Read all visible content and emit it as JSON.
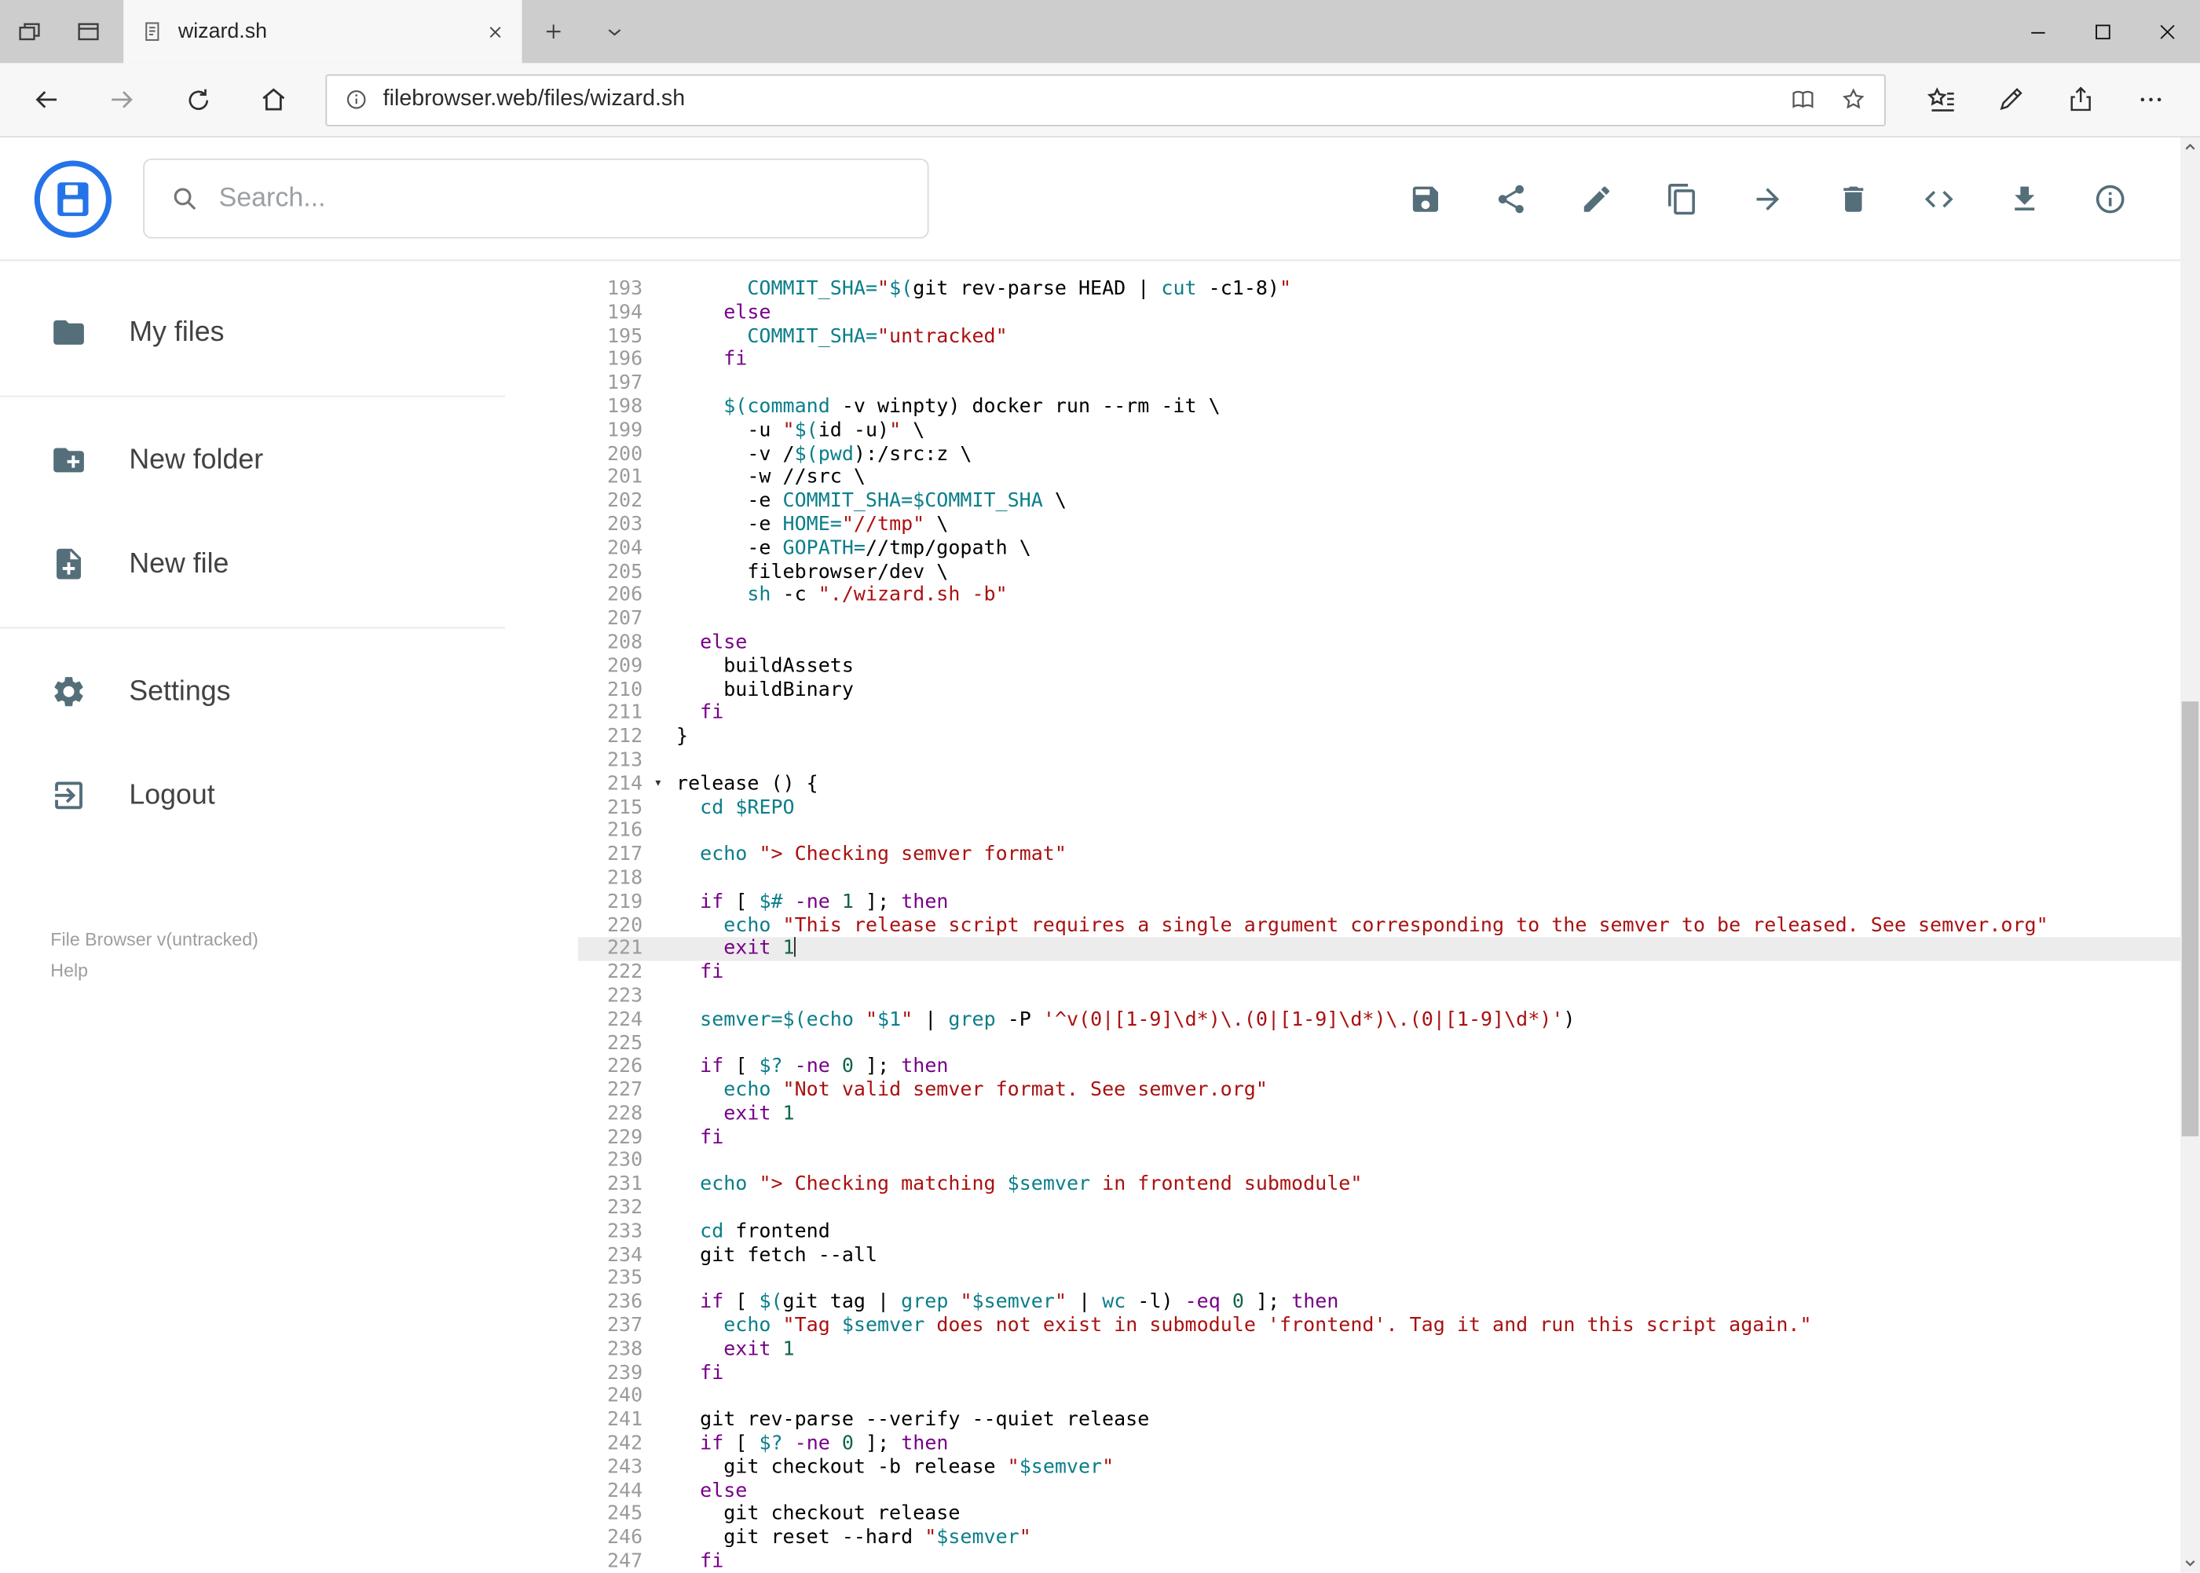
{
  "browser": {
    "tab": {
      "title": "wizard.sh"
    },
    "address": {
      "url": "filebrowser.web/files/wizard.sh"
    }
  },
  "app": {
    "search": {
      "placeholder": "Search..."
    },
    "toolbar_icons": [
      "save",
      "share",
      "edit",
      "copy",
      "move",
      "delete",
      "code",
      "download",
      "info"
    ],
    "sidebar": {
      "items": [
        {
          "label": "My files",
          "icon": "folder"
        },
        {
          "label": "New folder",
          "icon": "folder-plus"
        },
        {
          "label": "New file",
          "icon": "file-plus"
        },
        {
          "label": "Settings",
          "icon": "gear"
        },
        {
          "label": "Logout",
          "icon": "logout"
        }
      ],
      "footer": {
        "version": "File Browser v(untracked)",
        "help": "Help"
      }
    }
  },
  "colors": {
    "accent_blue": "#2573e8",
    "icon_gray": "#546e7a",
    "keyword": "#770088",
    "string": "#aa1111",
    "variable": "#0b7e8a",
    "number": "#116644",
    "line_number": "#9b9b9b",
    "active_line_bg": "#ececec"
  },
  "editor": {
    "active_line": 221,
    "fold_line": 214,
    "lines": [
      {
        "n": 193,
        "t": [
          [
            "p",
            "      "
          ],
          [
            "v",
            "COMMIT_SHA="
          ],
          [
            "s",
            "\""
          ],
          [
            "v",
            "$("
          ],
          [
            "p",
            "git rev-parse HEAD | "
          ],
          [
            "v",
            "cut"
          ],
          [
            "p",
            " -c1-8)"
          ],
          [
            "s",
            "\""
          ]
        ]
      },
      {
        "n": 194,
        "t": [
          [
            "p",
            "    "
          ],
          [
            "k",
            "else"
          ]
        ]
      },
      {
        "n": 195,
        "t": [
          [
            "p",
            "      "
          ],
          [
            "v",
            "COMMIT_SHA="
          ],
          [
            "s",
            "\"untracked\""
          ]
        ]
      },
      {
        "n": 196,
        "t": [
          [
            "p",
            "    "
          ],
          [
            "k",
            "fi"
          ]
        ]
      },
      {
        "n": 197,
        "t": []
      },
      {
        "n": 198,
        "t": [
          [
            "p",
            "    "
          ],
          [
            "v",
            "$(command"
          ],
          [
            "p",
            " -v winpty) docker run --rm -it \\"
          ]
        ]
      },
      {
        "n": 199,
        "t": [
          [
            "p",
            "      -u "
          ],
          [
            "s",
            "\""
          ],
          [
            "v",
            "$("
          ],
          [
            "p",
            "id -u)"
          ],
          [
            "s",
            "\""
          ],
          [
            "p",
            " \\"
          ]
        ]
      },
      {
        "n": 200,
        "t": [
          [
            "p",
            "      -v /"
          ],
          [
            "v",
            "$(pwd"
          ],
          [
            "p",
            "):/src:z \\"
          ]
        ]
      },
      {
        "n": 201,
        "t": [
          [
            "p",
            "      -w //src \\"
          ]
        ]
      },
      {
        "n": 202,
        "t": [
          [
            "p",
            "      -e "
          ],
          [
            "v",
            "COMMIT_SHA=$COMMIT_SHA"
          ],
          [
            "p",
            " \\"
          ]
        ]
      },
      {
        "n": 203,
        "t": [
          [
            "p",
            "      -e "
          ],
          [
            "v",
            "HOME="
          ],
          [
            "s",
            "\"//tmp\""
          ],
          [
            "p",
            " \\"
          ]
        ]
      },
      {
        "n": 204,
        "t": [
          [
            "p",
            "      -e "
          ],
          [
            "v",
            "GOPATH="
          ],
          [
            "p",
            "//tmp/gopath \\"
          ]
        ]
      },
      {
        "n": 205,
        "t": [
          [
            "p",
            "      filebrowser/dev \\"
          ]
        ]
      },
      {
        "n": 206,
        "t": [
          [
            "p",
            "      "
          ],
          [
            "v",
            "sh"
          ],
          [
            "p",
            " -c "
          ],
          [
            "s",
            "\"./wizard.sh -b\""
          ]
        ]
      },
      {
        "n": 207,
        "t": []
      },
      {
        "n": 208,
        "t": [
          [
            "p",
            "  "
          ],
          [
            "k",
            "else"
          ]
        ]
      },
      {
        "n": 209,
        "t": [
          [
            "p",
            "    buildAssets"
          ]
        ]
      },
      {
        "n": 210,
        "t": [
          [
            "p",
            "    buildBinary"
          ]
        ]
      },
      {
        "n": 211,
        "t": [
          [
            "p",
            "  "
          ],
          [
            "k",
            "fi"
          ]
        ]
      },
      {
        "n": 212,
        "t": [
          [
            "p",
            "}"
          ]
        ]
      },
      {
        "n": 213,
        "t": []
      },
      {
        "n": 214,
        "t": [
          [
            "p",
            "release () {"
          ]
        ]
      },
      {
        "n": 215,
        "t": [
          [
            "p",
            "  "
          ],
          [
            "v",
            "cd"
          ],
          [
            "p",
            " "
          ],
          [
            "v",
            "$REPO"
          ]
        ]
      },
      {
        "n": 216,
        "t": []
      },
      {
        "n": 217,
        "t": [
          [
            "p",
            "  "
          ],
          [
            "v",
            "echo"
          ],
          [
            "p",
            " "
          ],
          [
            "s",
            "\"> Checking semver format\""
          ]
        ]
      },
      {
        "n": 218,
        "t": []
      },
      {
        "n": 219,
        "t": [
          [
            "p",
            "  "
          ],
          [
            "k",
            "if"
          ],
          [
            "p",
            " [ "
          ],
          [
            "v",
            "$#"
          ],
          [
            "p",
            " "
          ],
          [
            "k",
            "-ne"
          ],
          [
            "p",
            " "
          ],
          [
            "n",
            "1"
          ],
          [
            "p",
            " ]; "
          ],
          [
            "k",
            "then"
          ]
        ]
      },
      {
        "n": 220,
        "t": [
          [
            "p",
            "    "
          ],
          [
            "v",
            "echo"
          ],
          [
            "p",
            " "
          ],
          [
            "s",
            "\"This release script requires a single argument corresponding to the semver to be released. See semver.org\""
          ]
        ]
      },
      {
        "n": 221,
        "t": [
          [
            "p",
            "    "
          ],
          [
            "k",
            "exit"
          ],
          [
            "p",
            " "
          ],
          [
            "n",
            "1"
          ]
        ]
      },
      {
        "n": 222,
        "t": [
          [
            "p",
            "  "
          ],
          [
            "k",
            "fi"
          ]
        ]
      },
      {
        "n": 223,
        "t": []
      },
      {
        "n": 224,
        "t": [
          [
            "p",
            "  "
          ],
          [
            "v",
            "semver="
          ],
          [
            "v",
            "$("
          ],
          [
            "v",
            "echo"
          ],
          [
            "p",
            " "
          ],
          [
            "s",
            "\""
          ],
          [
            "v",
            "$1"
          ],
          [
            "s",
            "\""
          ],
          [
            "p",
            " | "
          ],
          [
            "v",
            "grep"
          ],
          [
            "p",
            " -P "
          ],
          [
            "s",
            "'^v(0|[1-9]\\d*)\\.(0|[1-9]\\d*)\\.(0|[1-9]\\d*)'"
          ],
          [
            "p",
            ")"
          ]
        ]
      },
      {
        "n": 225,
        "t": []
      },
      {
        "n": 226,
        "t": [
          [
            "p",
            "  "
          ],
          [
            "k",
            "if"
          ],
          [
            "p",
            " [ "
          ],
          [
            "v",
            "$?"
          ],
          [
            "p",
            " "
          ],
          [
            "k",
            "-ne"
          ],
          [
            "p",
            " "
          ],
          [
            "n",
            "0"
          ],
          [
            "p",
            " ]; "
          ],
          [
            "k",
            "then"
          ]
        ]
      },
      {
        "n": 227,
        "t": [
          [
            "p",
            "    "
          ],
          [
            "v",
            "echo"
          ],
          [
            "p",
            " "
          ],
          [
            "s",
            "\"Not valid semver format. See semver.org\""
          ]
        ]
      },
      {
        "n": 228,
        "t": [
          [
            "p",
            "    "
          ],
          [
            "k",
            "exit"
          ],
          [
            "p",
            " "
          ],
          [
            "n",
            "1"
          ]
        ]
      },
      {
        "n": 229,
        "t": [
          [
            "p",
            "  "
          ],
          [
            "k",
            "fi"
          ]
        ]
      },
      {
        "n": 230,
        "t": []
      },
      {
        "n": 231,
        "t": [
          [
            "p",
            "  "
          ],
          [
            "v",
            "echo"
          ],
          [
            "p",
            " "
          ],
          [
            "s",
            "\"> Checking matching "
          ],
          [
            "v",
            "$semver"
          ],
          [
            "s",
            " in frontend submodule\""
          ]
        ]
      },
      {
        "n": 232,
        "t": []
      },
      {
        "n": 233,
        "t": [
          [
            "p",
            "  "
          ],
          [
            "v",
            "cd"
          ],
          [
            "p",
            " frontend"
          ]
        ]
      },
      {
        "n": 234,
        "t": [
          [
            "p",
            "  git fetch --all"
          ]
        ]
      },
      {
        "n": 235,
        "t": []
      },
      {
        "n": 236,
        "t": [
          [
            "p",
            "  "
          ],
          [
            "k",
            "if"
          ],
          [
            "p",
            " [ "
          ],
          [
            "v",
            "$("
          ],
          [
            "p",
            "git tag | "
          ],
          [
            "v",
            "grep"
          ],
          [
            "p",
            " "
          ],
          [
            "s",
            "\""
          ],
          [
            "v",
            "$semver"
          ],
          [
            "s",
            "\""
          ],
          [
            "p",
            " | "
          ],
          [
            "v",
            "wc"
          ],
          [
            "p",
            " -l) "
          ],
          [
            "k",
            "-eq"
          ],
          [
            "p",
            " "
          ],
          [
            "n",
            "0"
          ],
          [
            "p",
            " ]; "
          ],
          [
            "k",
            "then"
          ]
        ]
      },
      {
        "n": 237,
        "t": [
          [
            "p",
            "    "
          ],
          [
            "v",
            "echo"
          ],
          [
            "p",
            " "
          ],
          [
            "s",
            "\"Tag "
          ],
          [
            "v",
            "$semver"
          ],
          [
            "s",
            " does not exist in submodule 'frontend'. Tag it and run this script again.\""
          ]
        ]
      },
      {
        "n": 238,
        "t": [
          [
            "p",
            "    "
          ],
          [
            "k",
            "exit"
          ],
          [
            "p",
            " "
          ],
          [
            "n",
            "1"
          ]
        ]
      },
      {
        "n": 239,
        "t": [
          [
            "p",
            "  "
          ],
          [
            "k",
            "fi"
          ]
        ]
      },
      {
        "n": 240,
        "t": []
      },
      {
        "n": 241,
        "t": [
          [
            "p",
            "  git rev-parse --verify --quiet release"
          ]
        ]
      },
      {
        "n": 242,
        "t": [
          [
            "p",
            "  "
          ],
          [
            "k",
            "if"
          ],
          [
            "p",
            " [ "
          ],
          [
            "v",
            "$?"
          ],
          [
            "p",
            " "
          ],
          [
            "k",
            "-ne"
          ],
          [
            "p",
            " "
          ],
          [
            "n",
            "0"
          ],
          [
            "p",
            " ]; "
          ],
          [
            "k",
            "then"
          ]
        ]
      },
      {
        "n": 243,
        "t": [
          [
            "p",
            "    git checkout -b release "
          ],
          [
            "s",
            "\""
          ],
          [
            "v",
            "$semver"
          ],
          [
            "s",
            "\""
          ]
        ]
      },
      {
        "n": 244,
        "t": [
          [
            "p",
            "  "
          ],
          [
            "k",
            "else"
          ]
        ]
      },
      {
        "n": 245,
        "t": [
          [
            "p",
            "    git checkout release"
          ]
        ]
      },
      {
        "n": 246,
        "t": [
          [
            "p",
            "    git reset --hard "
          ],
          [
            "s",
            "\""
          ],
          [
            "v",
            "$semver"
          ],
          [
            "s",
            "\""
          ]
        ]
      },
      {
        "n": 247,
        "t": [
          [
            "p",
            "  "
          ],
          [
            "k",
            "fi"
          ]
        ]
      }
    ]
  }
}
